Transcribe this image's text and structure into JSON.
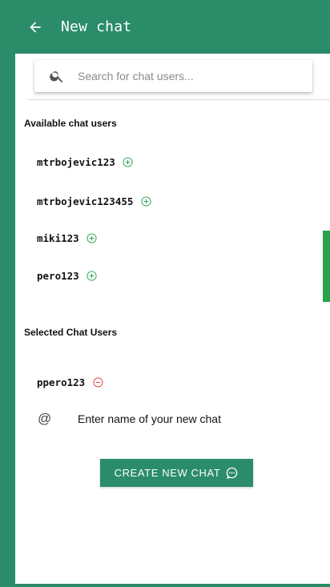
{
  "header": {
    "title": "New chat",
    "back_icon": "arrow-left-icon",
    "background": "#2b8c69"
  },
  "search": {
    "placeholder": "Search for chat users...",
    "icon": "search-icon"
  },
  "available": {
    "heading": "Available chat users",
    "users": [
      {
        "name": "mtrbojevic123",
        "action_icon": "add-circle-icon"
      },
      {
        "name": "mtrbojevic123455",
        "action_icon": "add-circle-icon"
      },
      {
        "name": "miki123",
        "action_icon": "add-circle-icon"
      },
      {
        "name": "pero123",
        "action_icon": "add-circle-icon"
      }
    ]
  },
  "selected": {
    "heading": "Selected Chat Users",
    "users": [
      {
        "name": "ppero123",
        "action_icon": "remove-circle-icon"
      }
    ]
  },
  "chat_name": {
    "icon": "at-icon",
    "icon_text": "@",
    "placeholder": "Enter name of your new chat"
  },
  "create_button": {
    "label": "CREATE NEW CHAT",
    "icon": "chat-bubble-icon"
  },
  "colors": {
    "primary": "#2b8c69",
    "add": "#2aa14d",
    "remove": "#e53935"
  }
}
